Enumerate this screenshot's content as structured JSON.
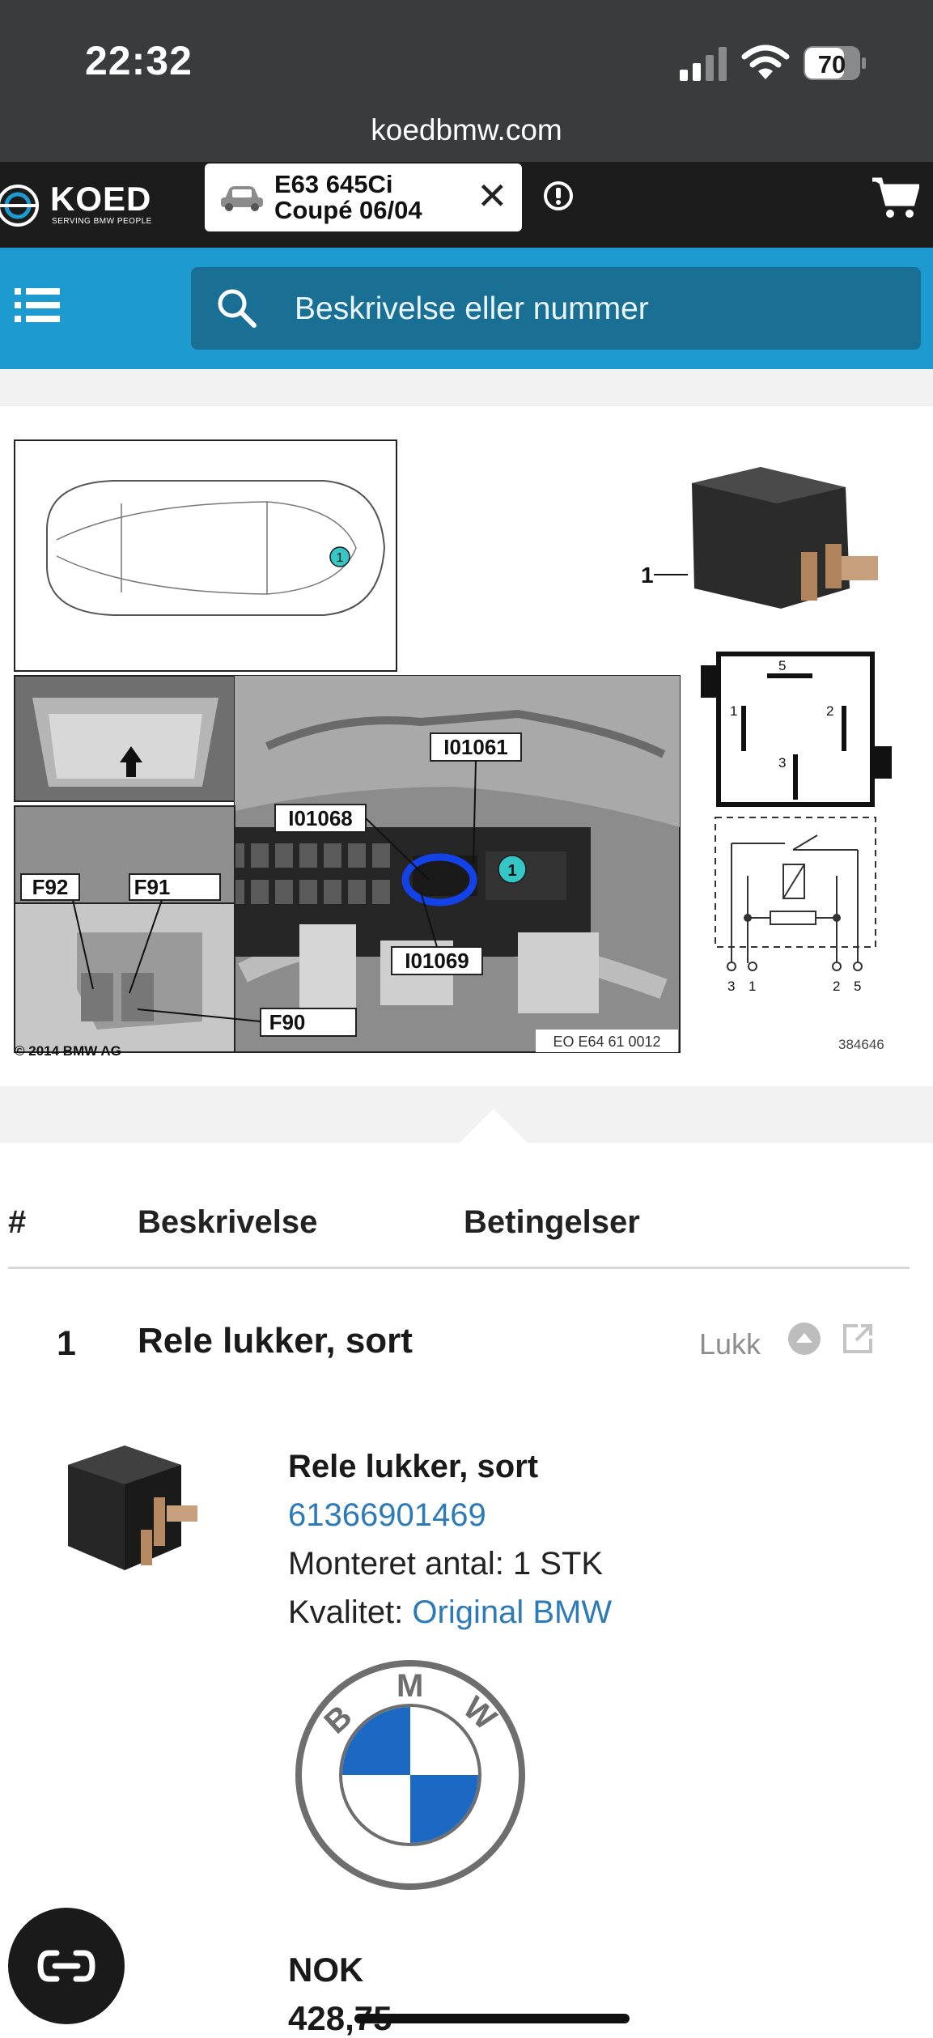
{
  "status_bar": {
    "time": "22:32",
    "battery": "70",
    "url": "koedbmw.com"
  },
  "header": {
    "logo_word": "KOED",
    "logo_tagline": "SERVING BMW PEOPLE",
    "vehicle_line1": "E63 645Ci",
    "vehicle_line2": "Coupé 06/04",
    "close_glyph": "✕"
  },
  "search": {
    "placeholder": "Beskrivelse eller nummer"
  },
  "diagram": {
    "labels": {
      "callout": "1",
      "connector_a": "I01061",
      "connector_b": "I01068",
      "connector_c": "I01069",
      "fuse_a": "F92",
      "fuse_b": "F91",
      "fuse_c": "F90",
      "copyright": "© 2014 BMW AG",
      "ref": "EO E64 61 0012",
      "image_no": "384646",
      "pin_5": "5",
      "pin_1": "1",
      "pin_2": "2",
      "pin_3": "3",
      "schem_pins": [
        "3",
        "1",
        "2",
        "5"
      ]
    }
  },
  "table": {
    "headers": {
      "num": "#",
      "description": "Beskrivelse",
      "conditions": "Betingelser"
    },
    "row": {
      "number": "1",
      "title": "Rele lukker, sort",
      "close_label": "Lukk",
      "part_name": "Rele lukker, sort",
      "part_number": "61366901469",
      "quantity": "Monteret antal: 1 STK",
      "quality_label": "Kvalitet: ",
      "quality_value": "Original BMW",
      "bmw_letters": [
        "B",
        "M",
        "W"
      ],
      "currency": "NOK",
      "price": "428,75"
    }
  },
  "colors": {
    "status_bg": "#3a3b3d",
    "header_bg": "#1c1c1c",
    "search_band": "#1d9bd0",
    "search_box": "#1a6f95",
    "link": "#2d7ab8",
    "callout_teal": "#35c6c6",
    "highlight_blue": "#1242e8"
  },
  "icons": [
    "signal-icon",
    "wifi-icon",
    "battery-icon",
    "car-icon",
    "info-icon",
    "cart-icon",
    "menu-icon",
    "search-icon",
    "collapse-up-icon",
    "external-link-icon",
    "chat-icon"
  ]
}
